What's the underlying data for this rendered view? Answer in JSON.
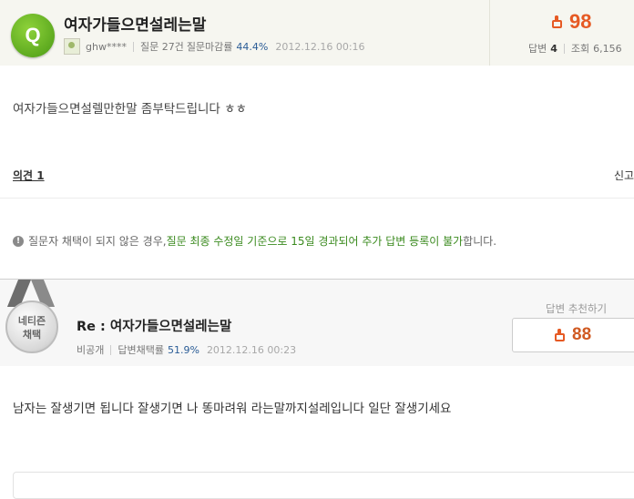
{
  "question": {
    "badge": "Q",
    "title": "여자가들으면설레는말",
    "author": "ghw****",
    "count_text": "질문 27건",
    "close_rate_label": "질문마감률",
    "close_rate_value": "44.4%",
    "datetime": "2012.12.16 00:16",
    "likes": "98",
    "answers_label": "답변",
    "answers_count": "4",
    "views_label": "조회",
    "views_count": "6,156",
    "body": "여자가들으면설렐만한말 좀부탁드립니다 ㅎㅎ"
  },
  "opinions": {
    "label": "의견 1",
    "report_label": "신고"
  },
  "notice": {
    "icon": "info-icon",
    "text_plain_1": "질문자 채택이 되지 않은 경우, ",
    "text_green": "질문 최종 수정일 기준으로 15일 경과되어 추가 답변 등록이 불가",
    "text_plain_2": "합니다."
  },
  "answer": {
    "medal_line1": "네티즌",
    "medal_line2": "채택",
    "title": "Re : 여자가들으면설레는말",
    "author": "비공개",
    "adopt_label": "답변채택률",
    "adopt_rate": "51.9%",
    "datetime": "2012.12.16 00:23",
    "recommend_label": "답변 추천하기",
    "recommend_count": "88",
    "body": "남자는 잘생기면 됩니다 잘생기면 나 똥마려워 라는말까지설레입니다 일단 잘생기세요"
  },
  "colors": {
    "accent_orange": "#e65a24",
    "badge_green": "#5aa61c",
    "notice_green": "#3a8a1e"
  }
}
